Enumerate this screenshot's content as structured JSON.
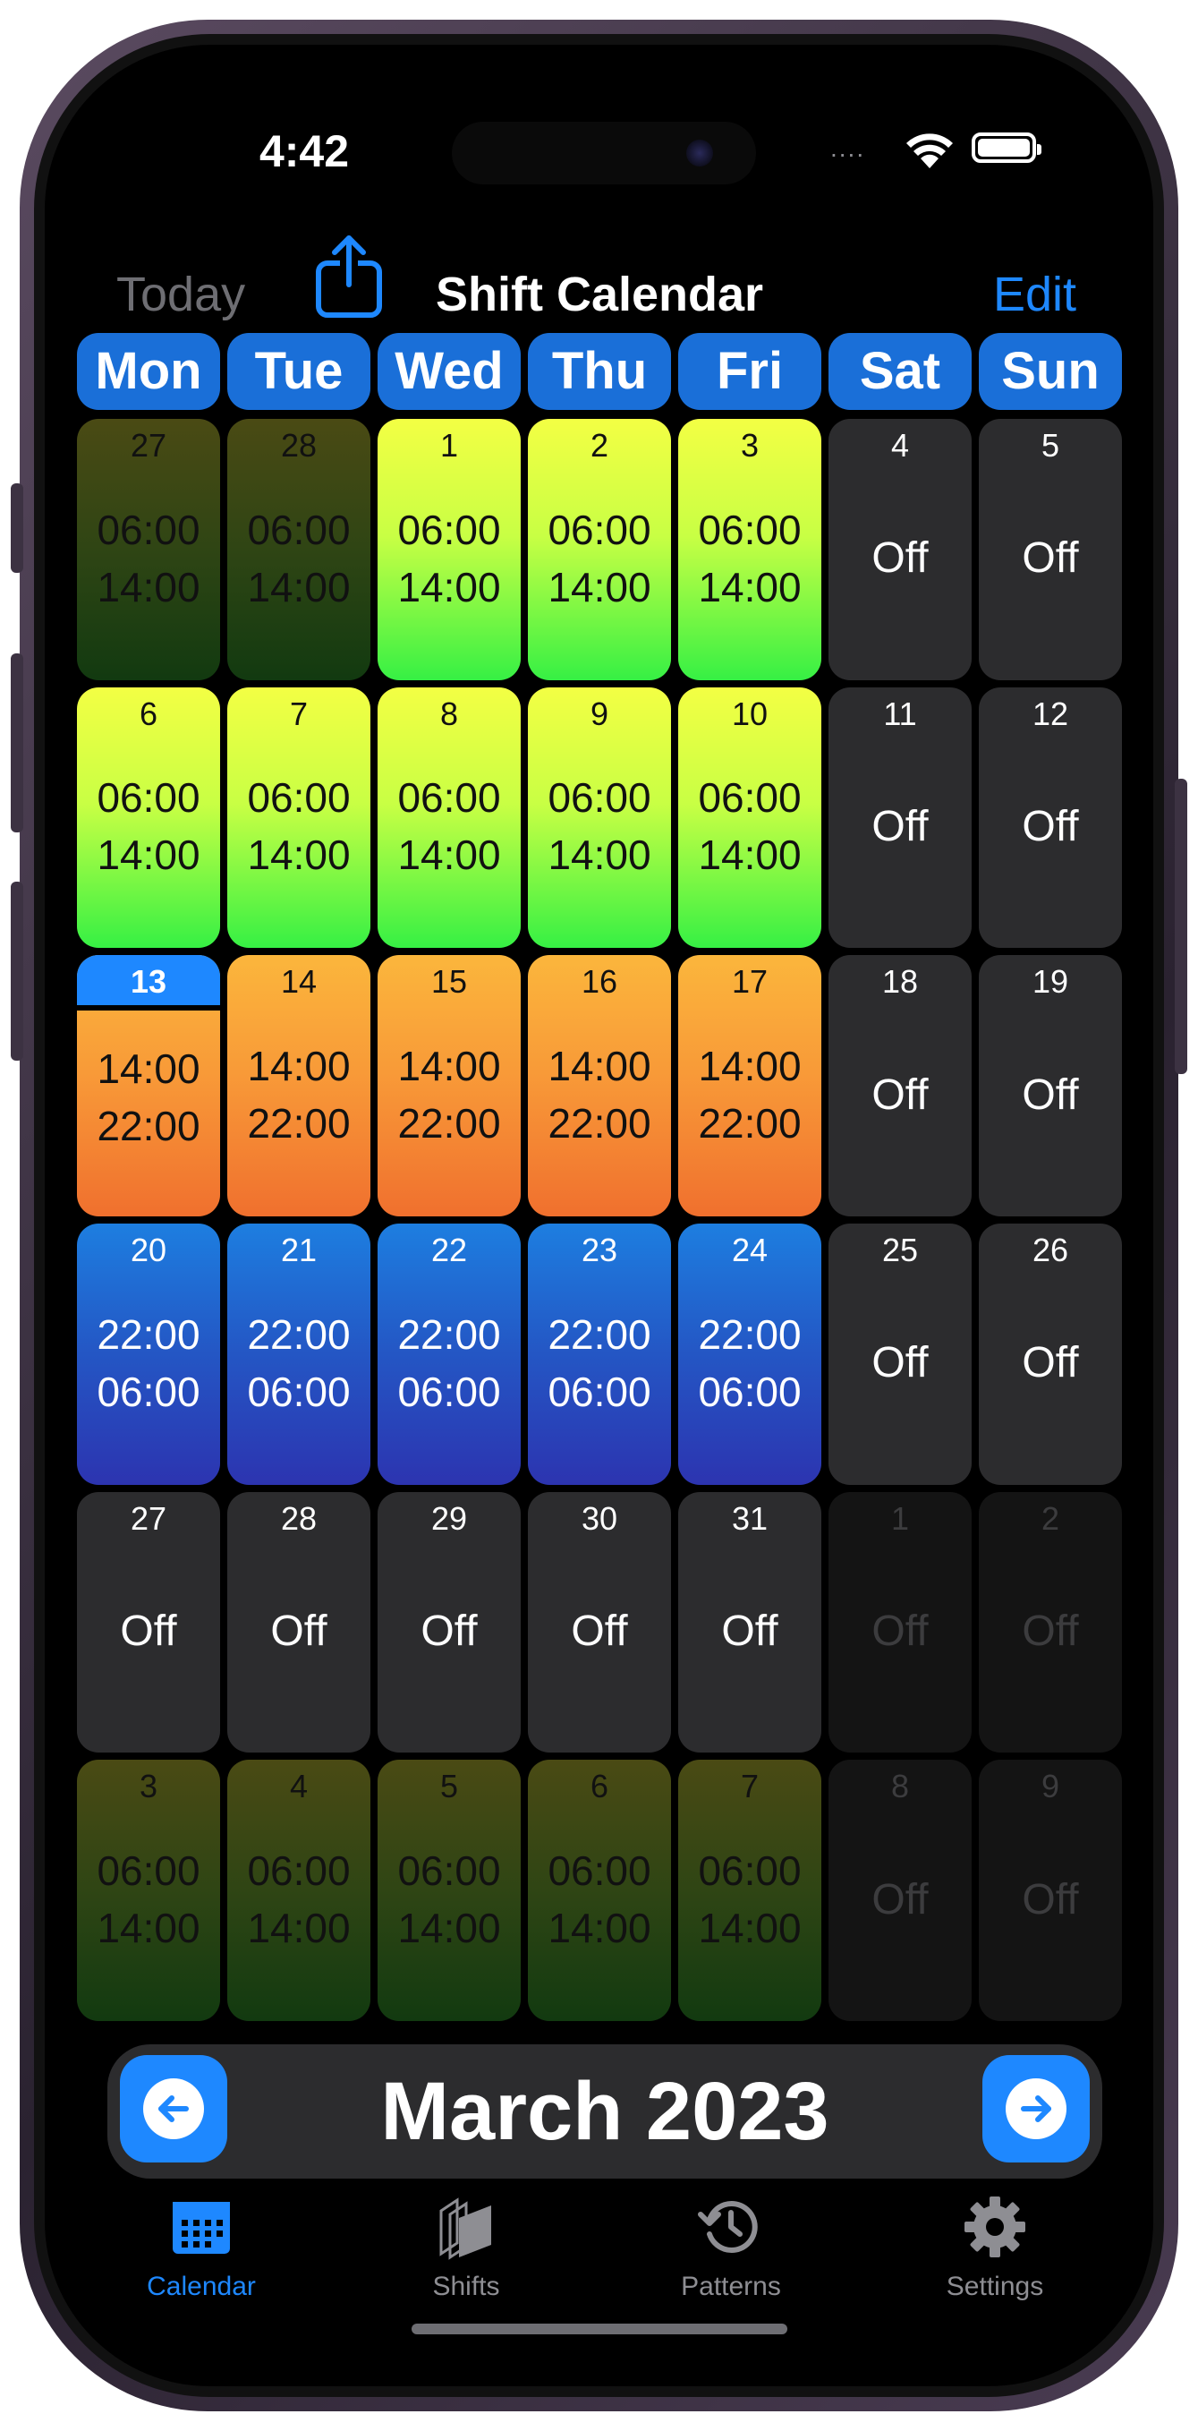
{
  "status_bar": {
    "time": "4:42",
    "signal_dots": "...."
  },
  "nav": {
    "today_label": "Today",
    "title": "Shift Calendar",
    "edit_label": "Edit"
  },
  "weekdays": [
    "Mon",
    "Tue",
    "Wed",
    "Thu",
    "Fri",
    "Sat",
    "Sun"
  ],
  "weeks": [
    [
      {
        "day": "27",
        "type": "early-dim",
        "start": "06:00",
        "end": "14:00"
      },
      {
        "day": "28",
        "type": "early-dim",
        "start": "06:00",
        "end": "14:00"
      },
      {
        "day": "1",
        "type": "early",
        "start": "06:00",
        "end": "14:00"
      },
      {
        "day": "2",
        "type": "early",
        "start": "06:00",
        "end": "14:00"
      },
      {
        "day": "3",
        "type": "early",
        "start": "06:00",
        "end": "14:00"
      },
      {
        "day": "4",
        "type": "off",
        "label": "Off"
      },
      {
        "day": "5",
        "type": "off",
        "label": "Off"
      }
    ],
    [
      {
        "day": "6",
        "type": "early",
        "start": "06:00",
        "end": "14:00"
      },
      {
        "day": "7",
        "type": "early",
        "start": "06:00",
        "end": "14:00"
      },
      {
        "day": "8",
        "type": "early",
        "start": "06:00",
        "end": "14:00"
      },
      {
        "day": "9",
        "type": "early",
        "start": "06:00",
        "end": "14:00"
      },
      {
        "day": "10",
        "type": "early",
        "start": "06:00",
        "end": "14:00"
      },
      {
        "day": "11",
        "type": "off",
        "label": "Off"
      },
      {
        "day": "12",
        "type": "off",
        "label": "Off"
      }
    ],
    [
      {
        "day": "13",
        "type": "late",
        "start": "14:00",
        "end": "22:00",
        "today": true
      },
      {
        "day": "14",
        "type": "late",
        "start": "14:00",
        "end": "22:00"
      },
      {
        "day": "15",
        "type": "late",
        "start": "14:00",
        "end": "22:00"
      },
      {
        "day": "16",
        "type": "late",
        "start": "14:00",
        "end": "22:00"
      },
      {
        "day": "17",
        "type": "late",
        "start": "14:00",
        "end": "22:00"
      },
      {
        "day": "18",
        "type": "off",
        "label": "Off"
      },
      {
        "day": "19",
        "type": "off",
        "label": "Off"
      }
    ],
    [
      {
        "day": "20",
        "type": "night",
        "start": "22:00",
        "end": "06:00"
      },
      {
        "day": "21",
        "type": "night",
        "start": "22:00",
        "end": "06:00"
      },
      {
        "day": "22",
        "type": "night",
        "start": "22:00",
        "end": "06:00"
      },
      {
        "day": "23",
        "type": "night",
        "start": "22:00",
        "end": "06:00"
      },
      {
        "day": "24",
        "type": "night",
        "start": "22:00",
        "end": "06:00"
      },
      {
        "day": "25",
        "type": "off",
        "label": "Off"
      },
      {
        "day": "26",
        "type": "off",
        "label": "Off"
      }
    ],
    [
      {
        "day": "27",
        "type": "off",
        "label": "Off"
      },
      {
        "day": "28",
        "type": "off",
        "label": "Off"
      },
      {
        "day": "29",
        "type": "off",
        "label": "Off"
      },
      {
        "day": "30",
        "type": "off",
        "label": "Off"
      },
      {
        "day": "31",
        "type": "off",
        "label": "Off"
      },
      {
        "day": "1",
        "type": "off-dim",
        "label": "Off"
      },
      {
        "day": "2",
        "type": "off-dim",
        "label": "Off"
      }
    ],
    [
      {
        "day": "3",
        "type": "early-dim",
        "start": "06:00",
        "end": "14:00"
      },
      {
        "day": "4",
        "type": "early-dim",
        "start": "06:00",
        "end": "14:00"
      },
      {
        "day": "5",
        "type": "early-dim",
        "start": "06:00",
        "end": "14:00"
      },
      {
        "day": "6",
        "type": "early-dim",
        "start": "06:00",
        "end": "14:00"
      },
      {
        "day": "7",
        "type": "early-dim",
        "start": "06:00",
        "end": "14:00"
      },
      {
        "day": "8",
        "type": "off-dim",
        "label": "Off"
      },
      {
        "day": "9",
        "type": "off-dim",
        "label": "Off"
      }
    ]
  ],
  "month_nav": {
    "label": "March 2023",
    "prev_icon": "arrow-left-icon",
    "next_icon": "arrow-right-icon"
  },
  "tabs": [
    {
      "label": "Calendar",
      "icon": "calendar-icon",
      "active": true
    },
    {
      "label": "Shifts",
      "icon": "shifts-icon",
      "active": false
    },
    {
      "label": "Patterns",
      "icon": "patterns-icon",
      "active": false
    },
    {
      "label": "Settings",
      "icon": "gear-icon",
      "active": false
    }
  ],
  "colors": {
    "accent": "#1e88ff",
    "weekday_header": "#1a6fd8",
    "early_shift": "#c8ff44",
    "late_shift": "#f89a38",
    "night_shift": "#2456c4",
    "off_day": "#2c2c2e"
  }
}
